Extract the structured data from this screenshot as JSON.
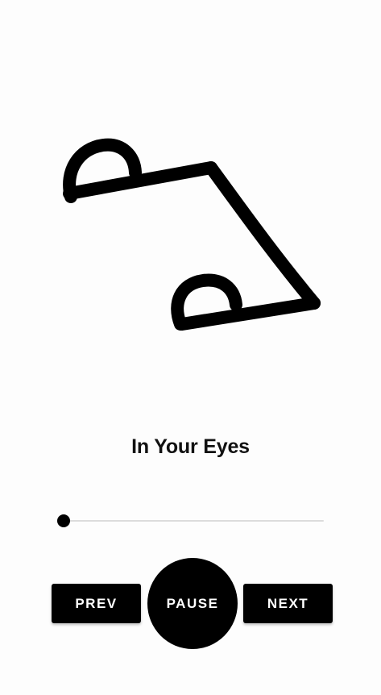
{
  "player": {
    "track_title": "In Your Eyes",
    "progress": 0.0,
    "artwork_icon": "hand-drawn-doodle-artwork"
  },
  "controls": {
    "prev_label": "PREV",
    "pause_label": "PAUSE",
    "next_label": "NEXT"
  },
  "colors": {
    "background": "#fdfdfd",
    "accent": "#000000",
    "button_text": "#ffffff",
    "track": "#dcdcdc"
  }
}
